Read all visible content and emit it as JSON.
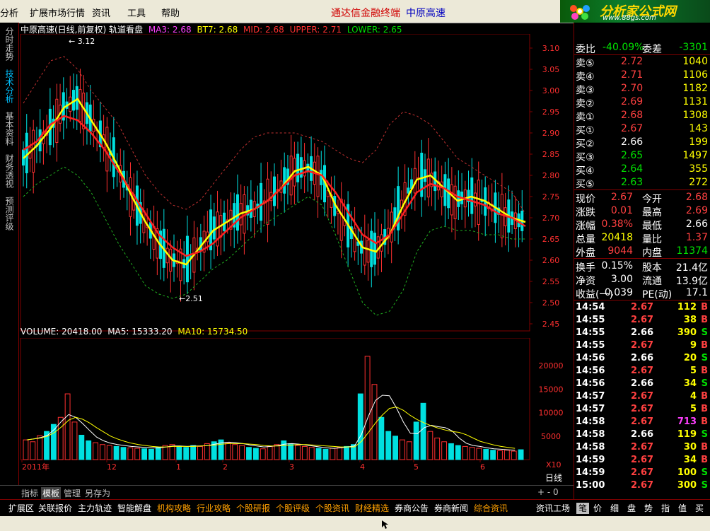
{
  "menu": {
    "items": [
      "分析",
      "扩展市场行情",
      "资讯",
      "工具",
      "帮助"
    ],
    "app_name": "通达信金融终端",
    "stock_name": "中原高速"
  },
  "logo": {
    "text": "分析家公式网",
    "sub": "www.88gs.com"
  },
  "sidebar": {
    "tabs": [
      "分时走势",
      "技术分析",
      "基本资料",
      "财务透视",
      "预测评级"
    ]
  },
  "chart": {
    "header": {
      "title": "中原高速(日线,前复权) 轨道看盘",
      "ma3": "MA3: 2.68",
      "bt7": "BT7: 2.68",
      "mid": "MID: 2.68",
      "upper": "UPPER: 2.71",
      "lower": "LOWER: 2.65"
    },
    "high_label": "3.12",
    "low_label": "2.51",
    "volume_header": {
      "volume": "VOLUME: 20418.00",
      "ma5": "MA5: 15333.20",
      "ma10": "MA10: 15734.50"
    },
    "x_axis": [
      "2011年",
      "12",
      "1",
      "2",
      "3",
      "4",
      "5",
      "6"
    ],
    "x10": "X10",
    "period": "日线",
    "zoom": "+ - 0",
    "colors": {
      "up": "#ff3030",
      "down": "#00e0e0",
      "ma": "#ffff00",
      "mid": "#ff2020",
      "band": "#c03030",
      "lower": "#20b020"
    }
  },
  "chart_data": [
    {
      "type": "line",
      "title": "中原高速(日线,前复权) 轨道看盘",
      "ylim": [
        2.45,
        3.12
      ],
      "y_ticks": [
        "3.10",
        "3.05",
        "3.00",
        "2.95",
        "2.90",
        "2.85",
        "2.80",
        "2.75",
        "2.70",
        "2.65",
        "2.60",
        "2.55",
        "2.50",
        "2.45"
      ],
      "x_labels": [
        "2011年",
        "12",
        "1",
        "2",
        "3",
        "4",
        "5",
        "6"
      ],
      "series": [
        {
          "name": "MA3",
          "values": [
            2.84,
            2.87,
            2.91,
            2.96,
            2.98,
            2.93,
            2.88,
            2.82,
            2.75,
            2.69,
            2.64,
            2.6,
            2.59,
            2.63,
            2.67,
            2.69,
            2.71,
            2.72,
            2.74,
            2.77,
            2.81,
            2.82,
            2.8,
            2.73,
            2.68,
            2.63,
            2.62,
            2.66,
            2.73,
            2.79,
            2.8,
            2.77,
            2.74,
            2.75,
            2.74,
            2.72,
            2.7,
            2.69
          ]
        },
        {
          "name": "MID",
          "values": [
            2.86,
            2.88,
            2.92,
            2.94,
            2.93,
            2.9,
            2.86,
            2.81,
            2.76,
            2.71,
            2.66,
            2.63,
            2.61,
            2.62,
            2.64,
            2.67,
            2.7,
            2.72,
            2.74,
            2.77,
            2.8,
            2.81,
            2.8,
            2.76,
            2.71,
            2.66,
            2.64,
            2.66,
            2.71,
            2.76,
            2.78,
            2.77,
            2.75,
            2.74,
            2.73,
            2.71,
            2.7,
            2.68
          ]
        },
        {
          "name": "UPPER",
          "values": [
            2.97,
            3.02,
            3.07,
            3.08,
            3.05,
            3.0,
            2.96,
            2.92,
            2.86,
            2.8,
            2.76,
            2.73,
            2.72,
            2.74,
            2.78,
            2.82,
            2.86,
            2.89,
            2.9,
            2.9,
            2.9,
            2.89,
            2.88,
            2.86,
            2.84,
            2.83,
            2.86,
            2.92,
            2.95,
            2.94,
            2.92,
            2.88,
            2.84,
            2.82,
            2.8,
            2.78,
            2.76,
            2.71
          ]
        },
        {
          "name": "LOWER",
          "values": [
            2.75,
            2.78,
            2.8,
            2.82,
            2.8,
            2.76,
            2.7,
            2.64,
            2.59,
            2.54,
            2.52,
            2.51,
            2.52,
            2.55,
            2.58,
            2.6,
            2.63,
            2.66,
            2.69,
            2.71,
            2.73,
            2.75,
            2.73,
            2.66,
            2.58,
            2.5,
            2.47,
            2.48,
            2.53,
            2.62,
            2.67,
            2.68,
            2.67,
            2.67,
            2.66,
            2.66,
            2.65,
            2.65
          ]
        }
      ]
    },
    {
      "type": "bar",
      "title": "VOLUME: 20418.00",
      "ylim": [
        0,
        25000
      ],
      "y_ticks": [
        "20000",
        "15000",
        "10000",
        "5000"
      ],
      "values": [
        4200,
        3800,
        5100,
        6000,
        7500,
        9000,
        14000,
        8000,
        5200,
        4000,
        3600,
        3200,
        3000,
        2800,
        2600,
        2500,
        2400,
        2300,
        2200,
        2600,
        3000,
        3200,
        2800,
        2600,
        3000,
        2800,
        3400,
        3800,
        4200,
        3600,
        3200,
        3000,
        2600,
        2400,
        2300,
        2800,
        3200,
        4000,
        3400,
        3000,
        2800,
        2600,
        2400,
        2200,
        2400,
        2600,
        2800,
        3200,
        14000,
        22000,
        16000,
        9000,
        6000,
        5000,
        4200,
        3800,
        8000,
        12000,
        6000,
        4600,
        3800,
        3400,
        3000,
        2800,
        2600,
        2400,
        2200,
        2000,
        1900,
        2000,
        1800,
        2100
      ],
      "series": [
        {
          "name": "MA5",
          "values": [
            4200,
            4400,
            4700,
            5200,
            6500,
            8200,
            9600,
            9000,
            7700,
            6200,
            4800,
            4000,
            3500,
            3200,
            3000,
            2800,
            2700,
            2600,
            2500,
            2500,
            2700,
            2900,
            2900,
            2800,
            2900,
            2900,
            3000,
            3300,
            3600,
            3700,
            3600,
            3400,
            3100,
            2900,
            2700,
            2800,
            3000,
            3300,
            3400,
            3300,
            3100,
            2900,
            2700,
            2500,
            2400,
            2500,
            2700,
            2900,
            5400,
            9300,
            12600,
            13700,
            13600,
            11000,
            8000,
            5600,
            5500,
            6800,
            7300,
            7000,
            6800,
            6100,
            4600,
            3500,
            3000,
            2800,
            2500,
            2300,
            2200,
            2100,
            2000,
            20418
          ]
        },
        {
          "name": "MA10",
          "values": [
            4200,
            4400,
            4600,
            5000,
            5800,
            7000,
            8400,
            9000,
            8600,
            7800,
            6800,
            5900,
            5000,
            4400,
            3900,
            3500,
            3200,
            3000,
            2800,
            2700,
            2700,
            2800,
            2800,
            2800,
            2800,
            2900,
            3000,
            3100,
            3300,
            3400,
            3400,
            3400,
            3300,
            3200,
            3000,
            2900,
            2900,
            3000,
            3100,
            3200,
            3200,
            3100,
            3000,
            2900,
            2800,
            2700,
            2700,
            2700,
            3900,
            5800,
            7800,
            9500,
            10900,
            11200,
            10500,
            9400,
            8500,
            7800,
            7200,
            6700,
            6300,
            6000,
            5800,
            5300,
            4600,
            3900,
            3500,
            3100,
            2800,
            2600,
            2400,
            15734
          ]
        }
      ]
    }
  ],
  "quote": {
    "weibi_label": "委比",
    "weibi_value": "-40.09%",
    "weicha_label": "委差",
    "weicha_value": "-3301",
    "asks": [
      {
        "label": "卖⑤",
        "price": "2.72",
        "vol": "1040"
      },
      {
        "label": "卖④",
        "price": "2.71",
        "vol": "1106"
      },
      {
        "label": "卖③",
        "price": "2.70",
        "vol": "1182"
      },
      {
        "label": "卖②",
        "price": "2.69",
        "vol": "1131"
      },
      {
        "label": "卖①",
        "price": "2.68",
        "vol": "1308"
      }
    ],
    "bids": [
      {
        "label": "买①",
        "price": "2.67",
        "vol": "143",
        "pc": "red"
      },
      {
        "label": "买②",
        "price": "2.66",
        "vol": "199",
        "pc": "white"
      },
      {
        "label": "买③",
        "price": "2.65",
        "vol": "1497",
        "pc": "green"
      },
      {
        "label": "买④",
        "price": "2.64",
        "vol": "355",
        "pc": "green"
      },
      {
        "label": "买⑤",
        "price": "2.63",
        "vol": "272",
        "pc": "green"
      }
    ],
    "stats": [
      {
        "l1": "现价",
        "v1": "2.67",
        "c1": "red",
        "l2": "今开",
        "v2": "2.68",
        "c2": "red"
      },
      {
        "l1": "涨跌",
        "v1": "0.01",
        "c1": "red",
        "l2": "最高",
        "v2": "2.69",
        "c2": "red"
      },
      {
        "l1": "涨幅",
        "v1": "0.38%",
        "c1": "red",
        "l2": "最低",
        "v2": "2.66",
        "c2": "white"
      },
      {
        "l1": "总量",
        "v1": "20418",
        "c1": "yellow",
        "l2": "量比",
        "v2": "1.37",
        "c2": "red"
      },
      {
        "l1": "外盘",
        "v1": "9044",
        "c1": "red",
        "l2": "内盘",
        "v2": "11374",
        "c2": "green"
      }
    ],
    "stats2": [
      {
        "l1": "换手",
        "v1": "0.15%",
        "c1": "white",
        "l2": "股本",
        "v2": "21.4亿",
        "c2": "white"
      },
      {
        "l1": "净资",
        "v1": "3.00",
        "c1": "white",
        "l2": "流通",
        "v2": "13.9亿",
        "c2": "white"
      },
      {
        "l1": "收益(一)",
        "v1": "0.039",
        "c1": "white",
        "l2": "PE(动)",
        "v2": "17.1",
        "c2": "white"
      }
    ],
    "ticks": [
      {
        "t": "14:54",
        "p": "2.67",
        "pc": "red",
        "v": "112",
        "vc": "yellow",
        "s": "B",
        "sc": "red"
      },
      {
        "t": "14:55",
        "p": "2.67",
        "pc": "red",
        "v": "38",
        "vc": "yellow",
        "s": "B",
        "sc": "red"
      },
      {
        "t": "14:55",
        "p": "2.66",
        "pc": "white",
        "v": "390",
        "vc": "yellow",
        "s": "S",
        "sc": "green"
      },
      {
        "t": "14:55",
        "p": "2.67",
        "pc": "red",
        "v": "9",
        "vc": "yellow",
        "s": "B",
        "sc": "red"
      },
      {
        "t": "14:56",
        "p": "2.66",
        "pc": "white",
        "v": "20",
        "vc": "yellow",
        "s": "S",
        "sc": "green"
      },
      {
        "t": "14:56",
        "p": "2.67",
        "pc": "red",
        "v": "5",
        "vc": "yellow",
        "s": "B",
        "sc": "red"
      },
      {
        "t": "14:56",
        "p": "2.66",
        "pc": "white",
        "v": "34",
        "vc": "yellow",
        "s": "S",
        "sc": "green"
      },
      {
        "t": "14:57",
        "p": "2.67",
        "pc": "red",
        "v": "4",
        "vc": "yellow",
        "s": "B",
        "sc": "red"
      },
      {
        "t": "14:57",
        "p": "2.67",
        "pc": "red",
        "v": "5",
        "vc": "yellow",
        "s": "B",
        "sc": "red"
      },
      {
        "t": "14:58",
        "p": "2.67",
        "pc": "red",
        "v": "713",
        "vc": "magenta",
        "s": "B",
        "sc": "red"
      },
      {
        "t": "14:58",
        "p": "2.66",
        "pc": "white",
        "v": "119",
        "vc": "yellow",
        "s": "S",
        "sc": "green"
      },
      {
        "t": "14:58",
        "p": "2.67",
        "pc": "red",
        "v": "30",
        "vc": "yellow",
        "s": "B",
        "sc": "red"
      },
      {
        "t": "14:59",
        "p": "2.67",
        "pc": "red",
        "v": "34",
        "vc": "yellow",
        "s": "B",
        "sc": "red"
      },
      {
        "t": "14:59",
        "p": "2.67",
        "pc": "red",
        "v": "100",
        "vc": "yellow",
        "s": "S",
        "sc": "green"
      },
      {
        "t": "15:00",
        "p": "2.67",
        "pc": "red",
        "v": "300",
        "vc": "yellow",
        "s": "S",
        "sc": "green"
      }
    ]
  },
  "chart_tabs": [
    {
      "label": "指标",
      "sel": false
    },
    {
      "label": "模板",
      "sel": true
    },
    {
      "label": "管理",
      "sel": false,
      "color": "cyan"
    },
    {
      "label": "另存为",
      "sel": false
    }
  ],
  "bottom_tabs": [
    {
      "label": "扩展区",
      "color": "white"
    },
    {
      "label": "关联报价",
      "color": "white"
    },
    {
      "label": "主力轨迹",
      "color": "white"
    },
    {
      "label": "智能解盘",
      "color": "white"
    },
    {
      "label": "机构攻略",
      "color": "#ffa000"
    },
    {
      "label": "行业攻略",
      "color": "#ffa000"
    },
    {
      "label": "个股研报",
      "color": "#ffa000"
    },
    {
      "label": "个股评级",
      "color": "#ffa000"
    },
    {
      "label": "个股资讯",
      "color": "#ffa000"
    },
    {
      "label": "财经精选",
      "color": "#ffa000"
    },
    {
      "label": "券商公告",
      "color": "white"
    },
    {
      "label": "券商新闻",
      "color": "white"
    },
    {
      "label": "综合资讯",
      "color": "#ffa000"
    },
    {
      "label": "资讯工场",
      "color": "white"
    }
  ],
  "right_tabs": [
    "笔",
    "价",
    "细",
    "盘",
    "势",
    "指",
    "值",
    "买"
  ]
}
